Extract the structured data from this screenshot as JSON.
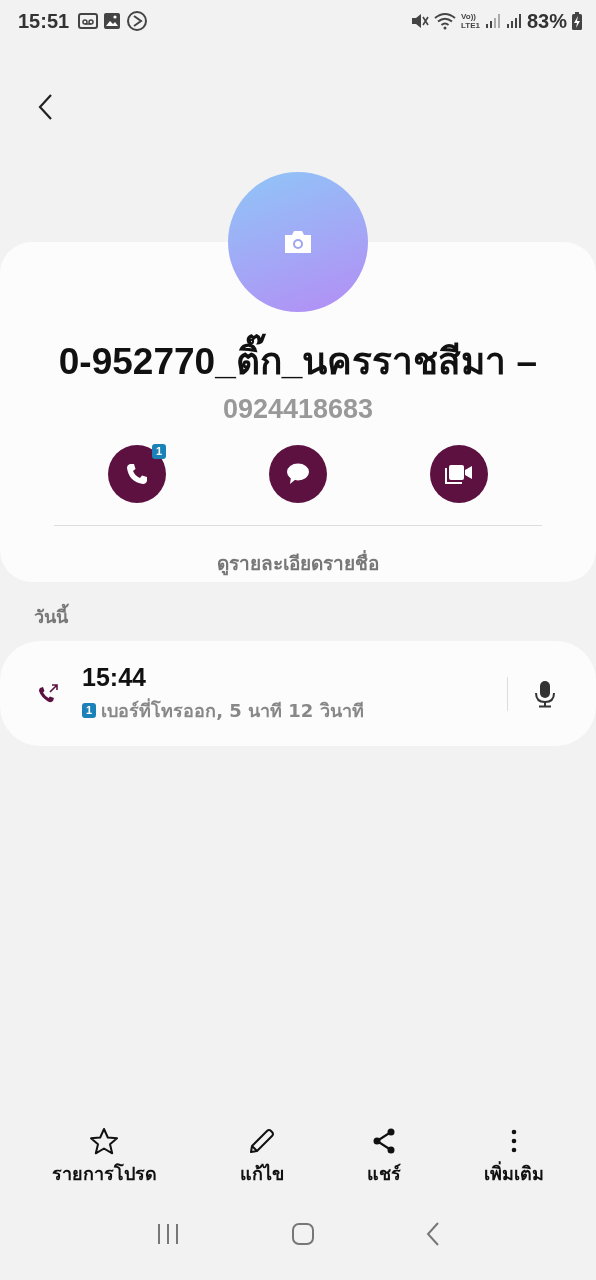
{
  "status_bar": {
    "time": "15:51",
    "volte": "Vo))",
    "network": "LTE1",
    "battery": "83%"
  },
  "contact": {
    "name": "0-952770_ติ๊ก_นครราชสีมา –",
    "number": "0924418683",
    "call_badge": "1",
    "details_link": "ดูรายละเอียดรายชื่อ"
  },
  "history": {
    "heading": "วันนี้",
    "calls": [
      {
        "time": "15:44",
        "sim": "1",
        "description": "เบอร์ที่โทรออก, 5 นาที 12 วินาที"
      }
    ]
  },
  "bottom_actions": [
    {
      "kind": "favorite",
      "label": "รายการโปรด"
    },
    {
      "kind": "edit",
      "label": "แก้ไข"
    },
    {
      "kind": "share",
      "label": "แชร์"
    },
    {
      "kind": "more",
      "label": "เพิ่มเติม"
    }
  ]
}
